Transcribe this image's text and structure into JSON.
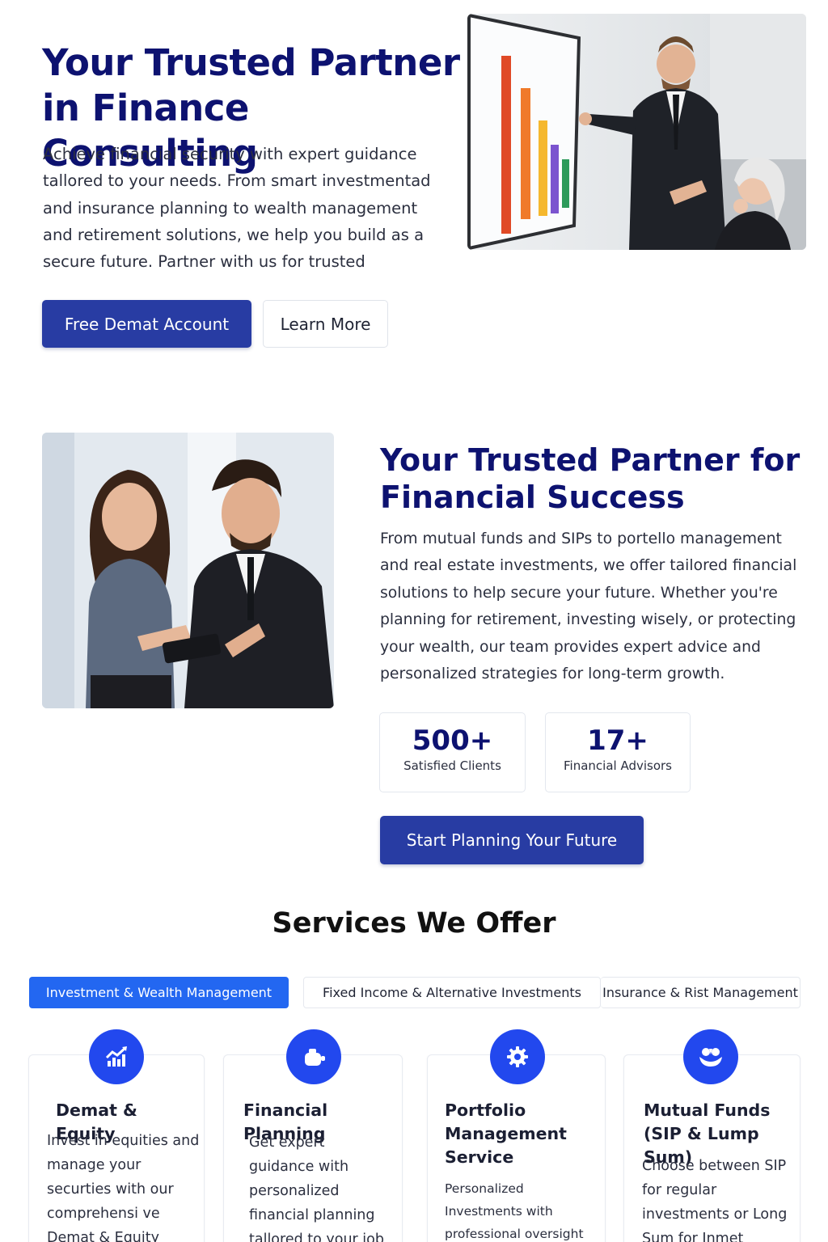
{
  "hero": {
    "title": "Your Trusted Partner in Finance Consulting",
    "description": "Achieve financial security with expert guidance tallored to your needs. From smart investmentad and insurance planning to wealth management and retirement solutions, we help you build as a secure future. Partner with us for trusted",
    "primary_button": "Free Demat Account",
    "secondary_button": "Learn More"
  },
  "about": {
    "title": "Your Trusted Partner for Financial Success",
    "description": "From mutual funds and SIPs to portello management and real estate investments, we offer tailored financial solutions to help secure your future. Whether you're planning for retirement, investing wisely, or protecting your wealth, our team provides expert advice and personalized strategies for long-term growth.",
    "stats": [
      {
        "value": "500+",
        "label": "Satisfied Clients"
      },
      {
        "value": "17+",
        "label": "Financial Advisors"
      }
    ],
    "cta_button": "Start Planning Your Future"
  },
  "services": {
    "title": "Services We Offer",
    "tabs": [
      {
        "label": "Investment & Wealth Management",
        "active": true
      },
      {
        "label": "Fixed Income & Alternative Investments",
        "active": false
      },
      {
        "label": "Insurance & Rist Management",
        "active": false
      }
    ],
    "cards": [
      {
        "icon": "growth-chart-icon",
        "title": "Demat & Equity",
        "text": "Invest in equities and manage your securties with our comprehensi ve Demat & Equity adlizlare-"
      },
      {
        "icon": "piggy-bank-icon",
        "title": "Financial Planning",
        "text": "Get expert guidance with personalized financial planning tallored to your job"
      },
      {
        "icon": "gear-icon",
        "title": "Portfolio Management Service",
        "text": "Personalized Investments with professional oversight to maximize"
      },
      {
        "icon": "coins-hand-icon",
        "title": "Mutual Funds (SIP & Lump Sum)",
        "text": "Choose between SIP for regular investments or Long Sum for Inmet wesching"
      }
    ]
  },
  "colors": {
    "heading": "#0d1270",
    "primary_button": "#283ca3",
    "active_tab": "#2367f1",
    "icon_circle": "#2248ee"
  }
}
